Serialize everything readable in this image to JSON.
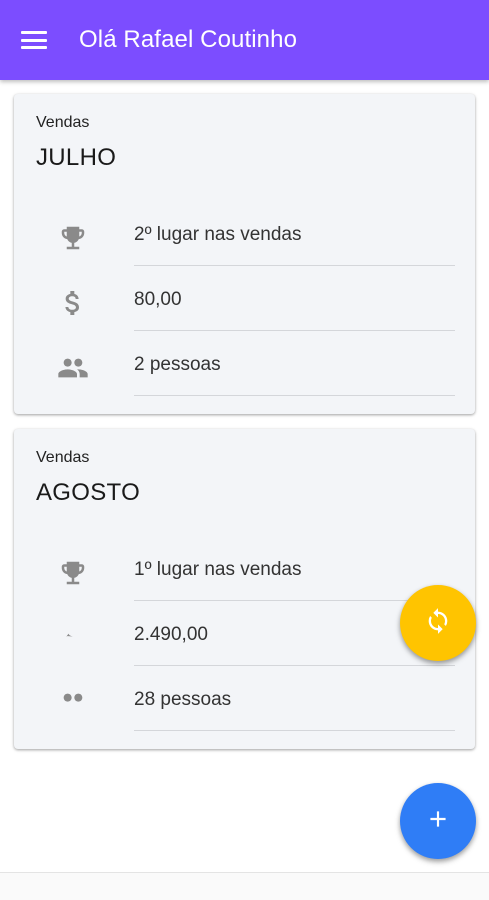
{
  "appbar": {
    "title": "Olá Rafael Coutinho",
    "color": "#7c4dff",
    "menu_icon": "menu-icon"
  },
  "cards": [
    {
      "overline": "Vendas",
      "month": "JULHO",
      "rows": [
        {
          "icon": "trophy-icon",
          "text": "2º lugar nas vendas"
        },
        {
          "icon": "dollar-icon",
          "text": "80,00"
        },
        {
          "icon": "people-icon",
          "text": "2 pessoas"
        }
      ]
    },
    {
      "overline": "Vendas",
      "month": "AGOSTO",
      "rows": [
        {
          "icon": "trophy-icon",
          "text": "1º lugar nas vendas"
        },
        {
          "icon": "dollar-icon",
          "text": "2.490,00"
        },
        {
          "icon": "people-icon",
          "text": "28 pessoas"
        }
      ]
    }
  ],
  "fabs": {
    "refresh": {
      "icon": "sync-icon",
      "color": "#ffc400"
    },
    "add": {
      "icon": "plus-icon",
      "color": "#2f7df6"
    }
  }
}
